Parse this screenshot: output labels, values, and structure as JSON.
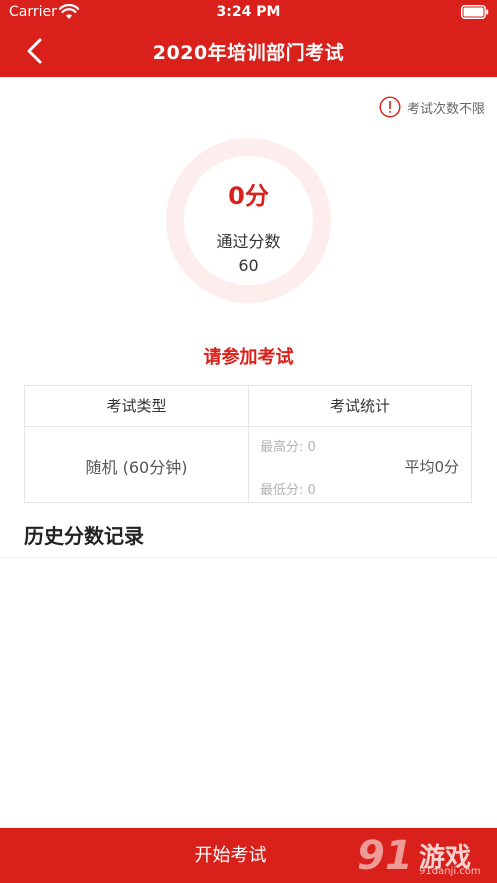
{
  "status_bar": {
    "carrier": "Carrier",
    "time": "3:24 PM"
  },
  "header": {
    "title": "2020年培训部门考试"
  },
  "attempts": {
    "text": "考试次数不限"
  },
  "score_ring": {
    "score": "0分",
    "pass_label": "通过分数",
    "pass_value": "60"
  },
  "join_prompt": "请参加考试",
  "info_table": {
    "type_header": "考试类型",
    "stats_header": "考试统计",
    "exam_type": "随机 (60分钟)",
    "max_score": "最高分: 0",
    "min_score": "最低分: 0",
    "average": "平均0分"
  },
  "history": {
    "title": "历史分数记录"
  },
  "start_button": {
    "label": "开始考试"
  },
  "watermark": {
    "number": "91",
    "text": "游戏",
    "url": "91danji.com"
  },
  "colors": {
    "brand_red": "#d9201a",
    "ring_light": "#fdeeed"
  }
}
